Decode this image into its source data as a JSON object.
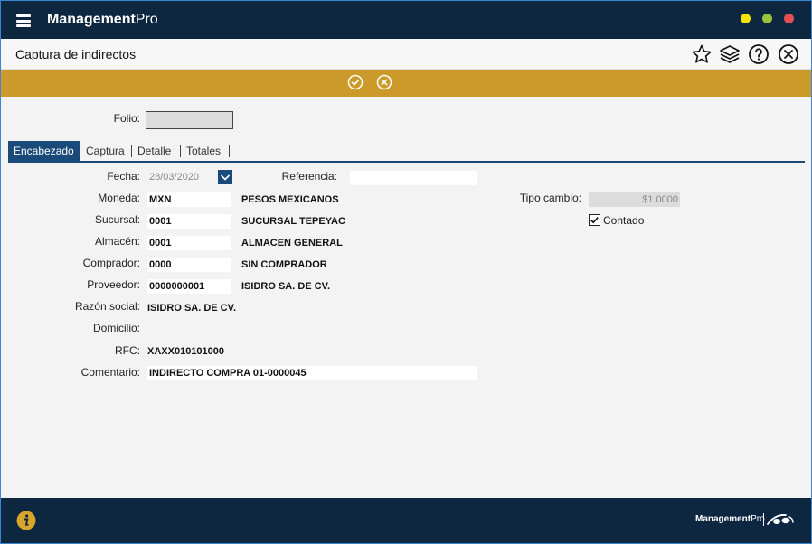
{
  "app": {
    "brand_bold": "Management",
    "brand_light": "Pro"
  },
  "window_controls": {
    "minimize_color": "#f2e600",
    "maximize_color": "#9bc23a",
    "close_color": "#e05050"
  },
  "screen_title": "Captura de indirectos",
  "toolbar_icons": [
    "star-icon",
    "layers-icon",
    "help-icon",
    "close-icon"
  ],
  "actions": [
    "confirm-icon",
    "cancel-icon"
  ],
  "folio": {
    "label": "Folio:",
    "value": ""
  },
  "tabs": [
    {
      "label": "Encabezado",
      "active": true
    },
    {
      "label": "Captura"
    },
    {
      "label": "Detalle"
    },
    {
      "label": "Totales"
    }
  ],
  "form": {
    "fecha": {
      "label": "Fecha:",
      "value": "28/03/2020"
    },
    "referencia": {
      "label": "Referencia:",
      "value": ""
    },
    "moneda": {
      "label": "Moneda:",
      "code": "MXN",
      "desc": "PESOS MEXICANOS"
    },
    "tipo_cambio": {
      "label": "Tipo cambio:",
      "value": "$1.0000"
    },
    "contado": {
      "label": "Contado",
      "checked": true
    },
    "sucursal": {
      "label": "Sucursal:",
      "code": "0001",
      "desc": "SUCURSAL TEPEYAC"
    },
    "almacen": {
      "label": "Almacén:",
      "code": "0001",
      "desc": "ALMACEN GENERAL"
    },
    "comprador": {
      "label": "Comprador:",
      "code": "0000",
      "desc": "SIN COMPRADOR"
    },
    "proveedor": {
      "label": "Proveedor:",
      "code": "0000000001",
      "desc": "ISIDRO SA. DE CV."
    },
    "razon_social": {
      "label": "Razón social:",
      "value": "ISIDRO SA. DE CV."
    },
    "domicilio": {
      "label": "Domicilio:",
      "value": ""
    },
    "rfc": {
      "label": "RFC:",
      "value": "XAXX010101000"
    },
    "comentario": {
      "label": "Comentario:",
      "value": "INDIRECTO COMPRA 01-0000045"
    }
  },
  "footer": {
    "brand_bold": "Management",
    "brand_light": "Pro",
    "info_icon": "info-icon"
  }
}
